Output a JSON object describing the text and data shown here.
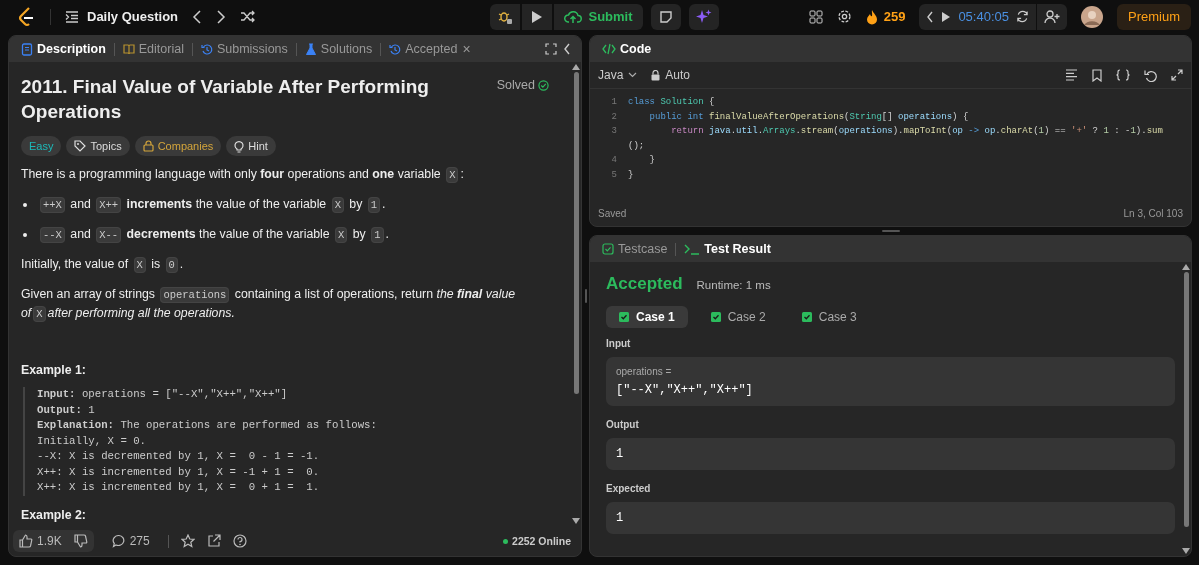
{
  "top_bar": {
    "title": "Daily Question",
    "submit": "Submit",
    "streak": "259",
    "timer": "05:40:05",
    "premium": "Premium"
  },
  "description_panel": {
    "tabs": [
      {
        "label": "Description",
        "selected": true
      },
      {
        "label": "Editorial",
        "selected": false
      },
      {
        "label": "Submissions",
        "selected": false
      },
      {
        "label": "Solutions",
        "selected": false
      },
      {
        "label": "Accepted",
        "selected": false,
        "close": "×"
      }
    ],
    "title": "2011. Final Value of Variable After Performing Operations",
    "status": "Solved",
    "tags": [
      {
        "label": "Easy",
        "kind": "difficulty"
      },
      {
        "label": "Topics",
        "kind": "topics"
      },
      {
        "label": "Companies",
        "kind": "companies"
      },
      {
        "label": "Hint",
        "kind": "hint"
      }
    ],
    "blocks": [
      {
        "kind": "paragraph",
        "parts": [
          {
            "kind": "text",
            "text": "There is a programming language with only **four** operations and **one** variable "
          },
          {
            "kind": "code",
            "text": "X"
          },
          {
            "kind": "text",
            "text": ":"
          }
        ]
      },
      {
        "kind": "bullet",
        "parts": [
          {
            "kind": "code",
            "text": "++X"
          },
          {
            "kind": "text",
            "text": " and "
          },
          {
            "kind": "code",
            "text": "X++"
          },
          {
            "kind": "text",
            "text": " **increments** the value of the variable "
          },
          {
            "kind": "code",
            "text": "X"
          },
          {
            "kind": "text",
            "text": " by "
          },
          {
            "kind": "code",
            "text": "1"
          },
          {
            "kind": "text",
            "text": "."
          }
        ]
      },
      {
        "kind": "bullet",
        "parts": [
          {
            "kind": "code",
            "text": "--X"
          },
          {
            "kind": "text",
            "text": " and "
          },
          {
            "kind": "code",
            "text": "X--"
          },
          {
            "kind": "text",
            "text": " **decrements** the value of the variable "
          },
          {
            "kind": "code",
            "text": "X"
          },
          {
            "kind": "text",
            "text": " by "
          },
          {
            "kind": "code",
            "text": "1"
          },
          {
            "kind": "text",
            "text": "."
          }
        ]
      },
      {
        "kind": "paragraph",
        "parts": [
          {
            "kind": "text",
            "text": "Initially, the value of "
          },
          {
            "kind": "code",
            "text": "X"
          },
          {
            "kind": "text",
            "text": " is "
          },
          {
            "kind": "code",
            "text": "0"
          },
          {
            "kind": "text",
            "text": "."
          }
        ]
      },
      {
        "kind": "paragraph",
        "parts": [
          {
            "kind": "text",
            "text": "Given an array of strings "
          },
          {
            "kind": "code",
            "text": "operations"
          },
          {
            "kind": "text",
            "text": " containing a list of operations, return "
          },
          {
            "kind": "italic",
            "text": "the **final** value of"
          },
          {
            "kind": "code",
            "text": "X"
          },
          {
            "kind": "italic",
            "text": "after performing all the operations."
          }
        ]
      }
    ],
    "examples": [
      {
        "heading": "Example 1:",
        "lines": [
          "**Input:** operations = [\"--X\",\"X++\",\"X++\"]",
          "**Output:** 1",
          "**Explanation:** The operations are performed as follows:",
          "Initially, X = 0.",
          "--X: X is decremented by 1, X =  0 - 1 = -1.",
          "X++: X is incremented by 1, X = -1 + 1 =  0.",
          "X++: X is incremented by 1, X =  0 + 1 =  1."
        ]
      },
      {
        "heading": "Example 2:"
      }
    ],
    "footer": {
      "likes": "1.9K",
      "comments": "275",
      "online": "2252 Online"
    }
  },
  "code_panel": {
    "title": "Code",
    "language": "Java",
    "mode": "Auto",
    "lines": [
      {
        "number": "1",
        "tokens": [
          {
            "kind": "keyword",
            "text": "class "
          },
          {
            "kind": "type",
            "text": "Solution"
          },
          {
            "kind": "plain",
            "text": " {"
          }
        ],
        "children": [
          {
            "number": "2",
            "tokens": [
              {
                "kind": "keyword",
                "text": "public "
              },
              {
                "kind": "keyword",
                "text": "int "
              },
              {
                "kind": "function",
                "text": "finalValueAfterOperations"
              },
              {
                "kind": "plain",
                "text": "("
              },
              {
                "kind": "type",
                "text": "String"
              },
              {
                "kind": "plain",
                "text": "[] "
              },
              {
                "kind": "variable",
                "text": "operations"
              },
              {
                "kind": "plain",
                "text": ") {"
              }
            ],
            "children": [
              {
                "number": "3",
                "tokens": [
                  {
                    "kind": "control",
                    "text": "return "
                  },
                  {
                    "kind": "variable",
                    "text": "java"
                  },
                  {
                    "kind": "plain",
                    "text": "."
                  },
                  {
                    "kind": "variable",
                    "text": "util"
                  },
                  {
                    "kind": "plain",
                    "text": "."
                  },
                  {
                    "kind": "type",
                    "text": "Arrays"
                  },
                  {
                    "kind": "plain",
                    "text": "."
                  },
                  {
                    "kind": "function",
                    "text": "stream"
                  },
                  {
                    "kind": "plain",
                    "text": "("
                  },
                  {
                    "kind": "variable",
                    "text": "operations"
                  },
                  {
                    "kind": "plain",
                    "text": ")."
                  },
                  {
                    "kind": "function",
                    "text": "mapToInt"
                  },
                  {
                    "kind": "plain",
                    "text": "("
                  },
                  {
                    "kind": "variable",
                    "text": "op "
                  },
                  {
                    "kind": "keyword",
                    "text": "-> "
                  },
                  {
                    "kind": "variable",
                    "text": "op"
                  },
                  {
                    "kind": "plain",
                    "text": "."
                  },
                  {
                    "kind": "function",
                    "text": "charAt"
                  },
                  {
                    "kind": "plain",
                    "text": "("
                  },
                  {
                    "kind": "number",
                    "text": "1"
                  },
                  {
                    "kind": "plain",
                    "text": ") == "
                  },
                  {
                    "kind": "string",
                    "text": "'+'"
                  },
                  {
                    "kind": "plain",
                    "text": " ? "
                  },
                  {
                    "kind": "number",
                    "text": "1"
                  },
                  {
                    "kind": "plain",
                    "text": " : -"
                  },
                  {
                    "kind": "number",
                    "text": "1"
                  },
                  {
                    "kind": "plain",
                    "text": ")."
                  },
                  {
                    "kind": "function",
                    "text": "sum"
                  }
                ],
                "wrapped_tokens": [
                  {
                    "kind": "plain",
                    "text": "();"
                  }
                ]
              }
            ]
          },
          {
            "number": "4",
            "tokens": [
              {
                "kind": "plain",
                "text": "}"
              }
            ]
          }
        ]
      },
      {
        "number": "5",
        "tokens": [
          {
            "kind": "plain",
            "text": "}"
          }
        ]
      }
    ],
    "save_state": "Saved",
    "cursor": "Ln 3, Col 103"
  },
  "result_panel": {
    "tabs": [
      {
        "label": "Testcase",
        "selected": false
      },
      {
        "label": "Test Result",
        "selected": true
      }
    ],
    "verdict": "Accepted",
    "runtime": "Runtime: 1 ms",
    "cases": [
      {
        "label": "Case 1",
        "selected": true
      },
      {
        "label": "Case 2",
        "selected": false
      },
      {
        "label": "Case 3",
        "selected": false
      }
    ],
    "input_label": "Input",
    "input_name": "operations =",
    "input_value": "[\"--X\",\"X++\",\"X++\"]",
    "output_label": "Output",
    "output_value": "1",
    "expected_label": "Expected",
    "expected_value": "1"
  }
}
